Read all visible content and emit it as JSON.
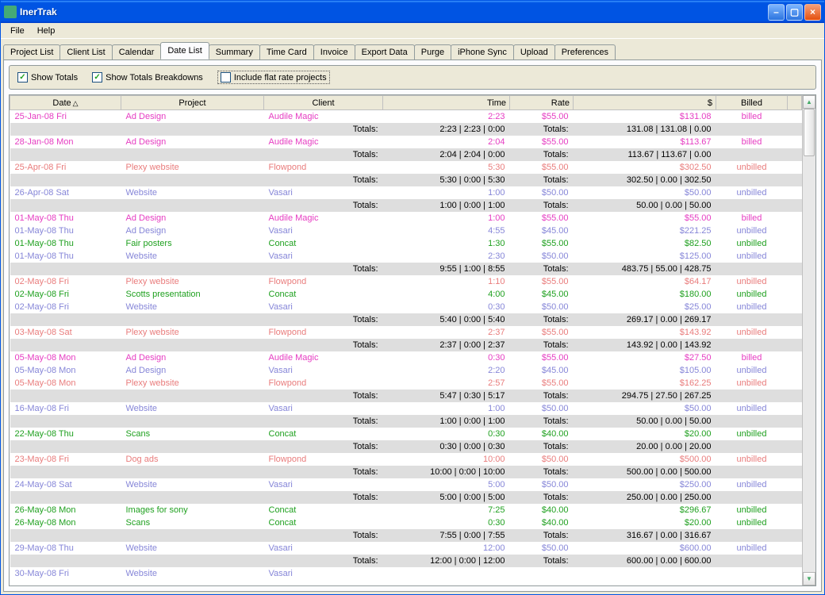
{
  "window": {
    "title": "InerTrak"
  },
  "menu": {
    "file": "File",
    "help": "Help"
  },
  "tabs": [
    "Project List",
    "Client List",
    "Calendar",
    "Date List",
    "Summary",
    "Time Card",
    "Invoice",
    "Export Data",
    "Purge",
    "iPhone Sync",
    "Upload",
    "Preferences"
  ],
  "activeTab": "Date List",
  "options": {
    "show_totals": "Show Totals",
    "show_breakdowns": "Show Totals Breakdowns",
    "flat_rate": "Include flat rate projects"
  },
  "columns": {
    "date": "Date",
    "project": "Project",
    "client": "Client",
    "time": "Time",
    "rate": "Rate",
    "amount": "$",
    "billed": "Billed"
  },
  "rows": [
    {
      "t": "d",
      "color": "pink",
      "date": "25-Jan-08 Fri",
      "project": "Ad Design",
      "client": "Audile Magic",
      "time": "2:23",
      "rate": "$55.00",
      "amount": "$131.08",
      "billed": "billed"
    },
    {
      "t": "s",
      "time": "2:23 | 2:23 | 0:00",
      "amount": "131.08 | 131.08 | 0.00"
    },
    {
      "t": "d",
      "color": "pink",
      "date": "28-Jan-08 Mon",
      "project": "Ad Design",
      "client": "Audile Magic",
      "time": "2:04",
      "rate": "$55.00",
      "amount": "$113.67",
      "billed": "billed"
    },
    {
      "t": "s",
      "time": "2:04 | 2:04 | 0:00",
      "amount": "113.67 | 113.67 | 0.00"
    },
    {
      "t": "d",
      "color": "salmon",
      "date": "25-Apr-08 Fri",
      "project": "Plexy website",
      "client": "Flowpond",
      "time": "5:30",
      "rate": "$55.00",
      "amount": "$302.50",
      "billed": "unbilled"
    },
    {
      "t": "s",
      "time": "5:30 | 0:00 | 5:30",
      "amount": "302.50 | 0.00 | 302.50"
    },
    {
      "t": "d",
      "color": "blue",
      "date": "26-Apr-08 Sat",
      "project": "Website",
      "client": "Vasari",
      "time": "1:00",
      "rate": "$50.00",
      "amount": "$50.00",
      "billed": "unbilled"
    },
    {
      "t": "s",
      "time": "1:00 | 0:00 | 1:00",
      "amount": "50.00 | 0.00 | 50.00"
    },
    {
      "t": "d",
      "color": "pink",
      "date": "01-May-08 Thu",
      "project": "Ad Design",
      "client": "Audile Magic",
      "time": "1:00",
      "rate": "$55.00",
      "amount": "$55.00",
      "billed": "billed"
    },
    {
      "t": "d",
      "color": "blue",
      "date": "01-May-08 Thu",
      "project": "Ad Design",
      "client": "Vasari",
      "time": "4:55",
      "rate": "$45.00",
      "amount": "$221.25",
      "billed": "unbilled"
    },
    {
      "t": "d",
      "color": "green",
      "date": "01-May-08 Thu",
      "project": "Fair posters",
      "client": "Concat",
      "time": "1:30",
      "rate": "$55.00",
      "amount": "$82.50",
      "billed": "unbilled"
    },
    {
      "t": "d",
      "color": "blue",
      "date": "01-May-08 Thu",
      "project": "Website",
      "client": "Vasari",
      "time": "2:30",
      "rate": "$50.00",
      "amount": "$125.00",
      "billed": "unbilled"
    },
    {
      "t": "s",
      "time": "9:55 | 1:00 | 8:55",
      "amount": "483.75 | 55.00 | 428.75"
    },
    {
      "t": "d",
      "color": "salmon",
      "date": "02-May-08 Fri",
      "project": "Plexy website",
      "client": "Flowpond",
      "time": "1:10",
      "rate": "$55.00",
      "amount": "$64.17",
      "billed": "unbilled"
    },
    {
      "t": "d",
      "color": "green",
      "date": "02-May-08 Fri",
      "project": "Scotts presentation",
      "client": "Concat",
      "time": "4:00",
      "rate": "$45.00",
      "amount": "$180.00",
      "billed": "unbilled"
    },
    {
      "t": "d",
      "color": "blue",
      "date": "02-May-08 Fri",
      "project": "Website",
      "client": "Vasari",
      "time": "0:30",
      "rate": "$50.00",
      "amount": "$25.00",
      "billed": "unbilled"
    },
    {
      "t": "s",
      "time": "5:40 | 0:00 | 5:40",
      "amount": "269.17 | 0.00 | 269.17"
    },
    {
      "t": "d",
      "color": "salmon",
      "date": "03-May-08 Sat",
      "project": "Plexy website",
      "client": "Flowpond",
      "time": "2:37",
      "rate": "$55.00",
      "amount": "$143.92",
      "billed": "unbilled"
    },
    {
      "t": "s",
      "time": "2:37 | 0:00 | 2:37",
      "amount": "143.92 | 0.00 | 143.92"
    },
    {
      "t": "d",
      "color": "pink",
      "date": "05-May-08 Mon",
      "project": "Ad Design",
      "client": "Audile Magic",
      "time": "0:30",
      "rate": "$55.00",
      "amount": "$27.50",
      "billed": "billed"
    },
    {
      "t": "d",
      "color": "blue",
      "date": "05-May-08 Mon",
      "project": "Ad Design",
      "client": "Vasari",
      "time": "2:20",
      "rate": "$45.00",
      "amount": "$105.00",
      "billed": "unbilled"
    },
    {
      "t": "d",
      "color": "salmon",
      "date": "05-May-08 Mon",
      "project": "Plexy website",
      "client": "Flowpond",
      "time": "2:57",
      "rate": "$55.00",
      "amount": "$162.25",
      "billed": "unbilled"
    },
    {
      "t": "s",
      "time": "5:47 | 0:30 | 5:17",
      "amount": "294.75 | 27.50 | 267.25"
    },
    {
      "t": "d",
      "color": "blue",
      "date": "16-May-08 Fri",
      "project": "Website",
      "client": "Vasari",
      "time": "1:00",
      "rate": "$50.00",
      "amount": "$50.00",
      "billed": "unbilled"
    },
    {
      "t": "s",
      "time": "1:00 | 0:00 | 1:00",
      "amount": "50.00 | 0.00 | 50.00"
    },
    {
      "t": "d",
      "color": "green",
      "date": "22-May-08 Thu",
      "project": "Scans",
      "client": "Concat",
      "time": "0:30",
      "rate": "$40.00",
      "amount": "$20.00",
      "billed": "unbilled"
    },
    {
      "t": "s",
      "time": "0:30 | 0:00 | 0:30",
      "amount": "20.00 | 0.00 | 20.00"
    },
    {
      "t": "d",
      "color": "salmon",
      "date": "23-May-08 Fri",
      "project": "Dog ads",
      "client": "Flowpond",
      "time": "10:00",
      "rate": "$50.00",
      "amount": "$500.00",
      "billed": "unbilled"
    },
    {
      "t": "s",
      "time": "10:00 | 0:00 | 10:00",
      "amount": "500.00 | 0.00 | 500.00"
    },
    {
      "t": "d",
      "color": "blue",
      "date": "24-May-08 Sat",
      "project": "Website",
      "client": "Vasari",
      "time": "5:00",
      "rate": "$50.00",
      "amount": "$250.00",
      "billed": "unbilled"
    },
    {
      "t": "s",
      "time": "5:00 | 0:00 | 5:00",
      "amount": "250.00 | 0.00 | 250.00"
    },
    {
      "t": "d",
      "color": "green",
      "date": "26-May-08 Mon",
      "project": "Images for sony",
      "client": "Concat",
      "time": "7:25",
      "rate": "$40.00",
      "amount": "$296.67",
      "billed": "unbilled"
    },
    {
      "t": "d",
      "color": "green",
      "date": "26-May-08 Mon",
      "project": "Scans",
      "client": "Concat",
      "time": "0:30",
      "rate": "$40.00",
      "amount": "$20.00",
      "billed": "unbilled"
    },
    {
      "t": "s",
      "time": "7:55 | 0:00 | 7:55",
      "amount": "316.67 | 0.00 | 316.67"
    },
    {
      "t": "d",
      "color": "blue",
      "date": "29-May-08 Thu",
      "project": "Website",
      "client": "Vasari",
      "time": "12:00",
      "rate": "$50.00",
      "amount": "$600.00",
      "billed": "unbilled"
    },
    {
      "t": "s",
      "time": "12:00 | 0:00 | 12:00",
      "amount": "600.00 | 0.00 | 600.00"
    },
    {
      "t": "d",
      "color": "blue",
      "date": "30-May-08 Fri",
      "project": "Website",
      "client": "Vasari",
      "time": "",
      "rate": "",
      "amount": "",
      "billed": ""
    }
  ],
  "totals_label": "Totals:"
}
